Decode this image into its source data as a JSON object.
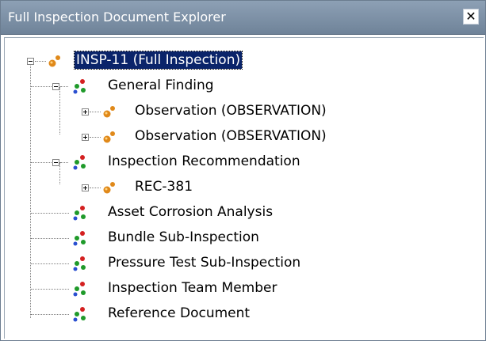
{
  "window": {
    "title": "Full Inspection Document Explorer",
    "close_glyph": "✕"
  },
  "tree": {
    "root": {
      "label": "INSP-11 (Full Inspection)",
      "icon": "entity-icon",
      "expanded": true,
      "selected": true
    },
    "general_finding": {
      "label": "General Finding",
      "icon": "relationship-family-icon",
      "expanded": true
    },
    "observation_1": {
      "label": "Observation (OBSERVATION)",
      "icon": "entity-icon",
      "expanded": false
    },
    "observation_2": {
      "label": "Observation (OBSERVATION)",
      "icon": "entity-icon",
      "expanded": false
    },
    "inspection_recommendation": {
      "label": "Inspection Recommendation",
      "icon": "relationship-family-icon",
      "expanded": true
    },
    "rec_381": {
      "label": "REC-381",
      "icon": "entity-icon",
      "expanded": false
    },
    "asset_corrosion": {
      "label": "Asset Corrosion Analysis",
      "icon": "relationship-family-icon"
    },
    "bundle_sub": {
      "label": "Bundle Sub-Inspection",
      "icon": "relationship-family-icon"
    },
    "pressure_test": {
      "label": "Pressure Test Sub-Inspection",
      "icon": "relationship-family-icon"
    },
    "team_member": {
      "label": "Inspection Team Member",
      "icon": "relationship-family-icon"
    },
    "reference_doc": {
      "label": "Reference Document",
      "icon": "relationship-family-icon"
    }
  },
  "colors": {
    "titlebar": "#7d90a6",
    "selection": "#0a246a",
    "entity_orange": "#e0891a",
    "family_red": "#d42020",
    "family_green": "#1f9a2a",
    "family_blue": "#2a4fd0"
  }
}
